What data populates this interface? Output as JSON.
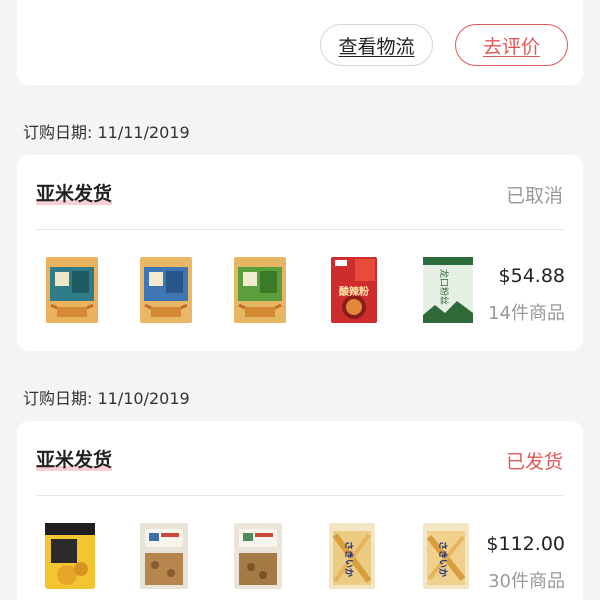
{
  "actions": {
    "logistics_label": "查看物流",
    "review_label": "去评价"
  },
  "orders": [
    {
      "date_label": "订购日期: 11/11/2019",
      "seller": "亚米发货",
      "status": "已取消",
      "status_color": "#999999",
      "price": "$54.88",
      "item_count": "14件商品",
      "products": [
        "rice-cracker-snack-bag",
        "rice-cracker-snack-bag",
        "rice-cracker-snack-bag",
        "hot-sour-noodles-box",
        "dried-noodles-bag"
      ],
      "product_text": {
        "hot_sour_noodles": "酸辣粉",
        "dried_noodles": "龙口粉丝"
      }
    },
    {
      "date_label": "订购日期: 11/10/2019",
      "seller": "亚米发货",
      "status": "已发货",
      "status_color": "#e05757",
      "price": "$112.00",
      "item_count": "30件商品",
      "products": [
        "yellow-snack-pouch",
        "kraft-snack-bag",
        "kraft-snack-bag",
        "squid-snack-bag",
        "squid-snack-bag"
      ],
      "product_text": {
        "squid_snack": "さきいか"
      }
    }
  ],
  "colors": {
    "accent": "#e05757",
    "background": "#f4f4f4",
    "card": "#ffffff"
  }
}
